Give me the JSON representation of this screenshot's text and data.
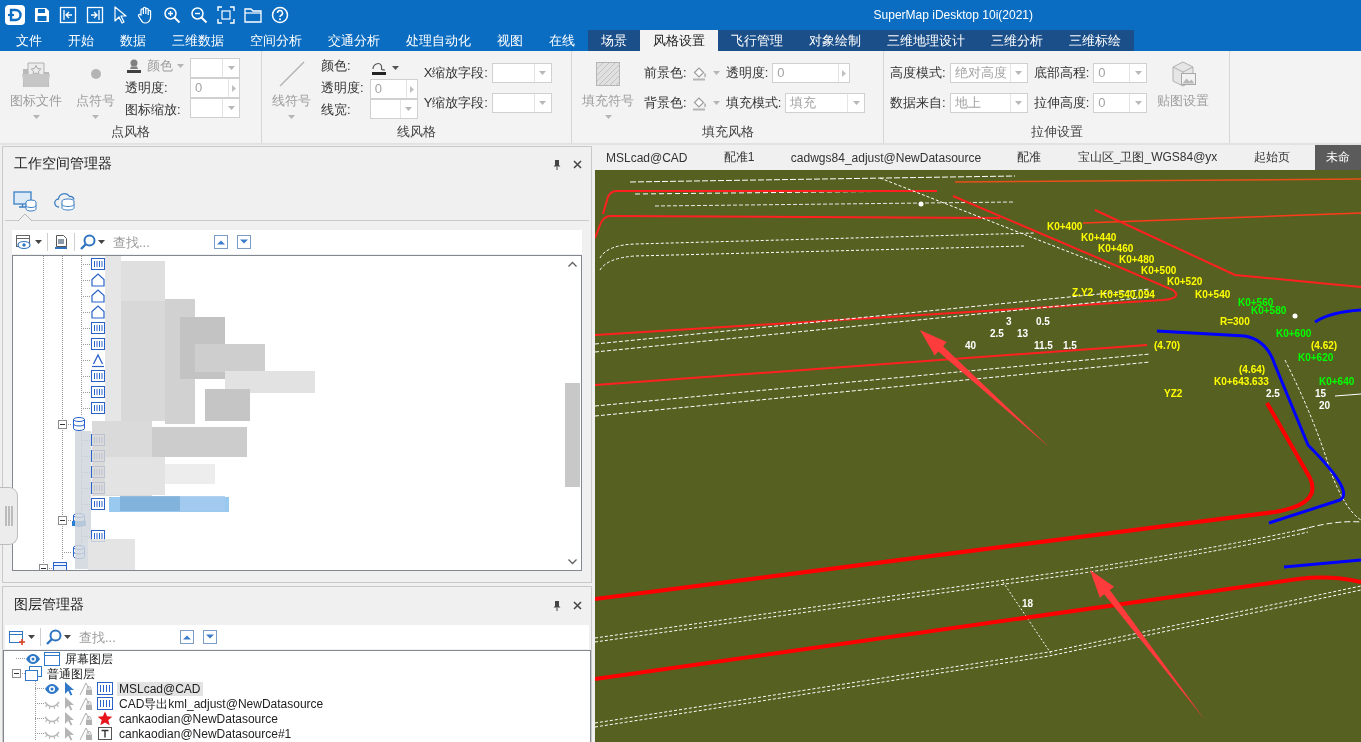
{
  "title_bar": {
    "title": "SuperMap iDesktop 10i(2021)"
  },
  "menu_tabs": [
    {
      "label": "文件",
      "selected": false,
      "contextual": false
    },
    {
      "label": "开始",
      "selected": false,
      "contextual": false
    },
    {
      "label": "数据",
      "selected": false,
      "contextual": false
    },
    {
      "label": "三维数据",
      "selected": false,
      "contextual": false
    },
    {
      "label": "空间分析",
      "selected": false,
      "contextual": false
    },
    {
      "label": "交通分析",
      "selected": false,
      "contextual": false
    },
    {
      "label": "处理自动化",
      "selected": false,
      "contextual": false
    },
    {
      "label": "视图",
      "selected": false,
      "contextual": false
    },
    {
      "label": "在线",
      "selected": false,
      "contextual": false
    },
    {
      "label": "场景",
      "selected": false,
      "contextual": true
    },
    {
      "label": "风格设置",
      "selected": true,
      "contextual": true
    },
    {
      "label": "飞行管理",
      "selected": false,
      "contextual": true
    },
    {
      "label": "对象绘制",
      "selected": false,
      "contextual": true
    },
    {
      "label": "三维地理设计",
      "selected": false,
      "contextual": true
    },
    {
      "label": "三维分析",
      "selected": false,
      "contextual": true
    },
    {
      "label": "三维标绘",
      "selected": false,
      "contextual": true
    }
  ],
  "ribbon": {
    "groups": [
      {
        "title": "点风格",
        "columns": [
          [
            {
              "kind": "large-button",
              "label": "图标文件",
              "disabled": true,
              "dropdown": true
            }
          ],
          [
            {
              "kind": "large-button",
              "label": "点符号",
              "disabled": true,
              "dropdown": true
            }
          ],
          [
            {
              "kind": "color-menu",
              "label": "颜色",
              "disabled": true
            },
            {
              "kind": "label",
              "label": "透明度:"
            },
            {
              "kind": "label",
              "label": "图标缩放:"
            }
          ],
          [
            {
              "kind": "combo",
              "disabled": true
            },
            {
              "kind": "spin",
              "value": "0",
              "disabled": true
            },
            {
              "kind": "combo",
              "disabled": true
            }
          ]
        ]
      },
      {
        "title": "线风格",
        "columns": [
          [
            {
              "kind": "large-button",
              "label": "线符号",
              "disabled": true,
              "dropdown": true
            }
          ],
          [
            {
              "kind": "label",
              "label": "颜色:"
            },
            {
              "kind": "label",
              "label": "透明度:"
            },
            {
              "kind": "label",
              "label": "线宽:"
            }
          ],
          [
            {
              "kind": "color-button",
              "disabled": false
            },
            {
              "kind": "spin",
              "value": "0",
              "disabled": true
            },
            {
              "kind": "combo",
              "disabled": true
            }
          ],
          [
            {
              "kind": "labeled-combo",
              "label": "X缩放字段:",
              "disabled": true
            },
            {
              "kind": "labeled-combo",
              "label": "Y缩放字段:",
              "disabled": true
            }
          ]
        ]
      },
      {
        "title": "填充风格",
        "columns": [
          [
            {
              "kind": "large-button",
              "label": "填充符号",
              "disabled": true,
              "dropdown": true
            }
          ],
          [
            {
              "kind": "labeled-color",
              "label": "前景色:",
              "disabled": true
            },
            {
              "kind": "labeled-color",
              "label": "背景色:",
              "disabled": true
            }
          ],
          [
            {
              "kind": "labeled-spin",
              "label": "透明度:",
              "value": "0",
              "disabled": true
            },
            {
              "kind": "labeled-combo",
              "label": "填充模式:",
              "value": "填充",
              "disabled": true
            }
          ]
        ]
      },
      {
        "title": "拉伸设置",
        "columns": [
          [
            {
              "kind": "labeled-combo",
              "label": "高度模式:",
              "value": "绝对高度",
              "disabled": true
            },
            {
              "kind": "labeled-combo",
              "label": "数据来自:",
              "value": "地上",
              "disabled": true
            }
          ],
          [
            {
              "kind": "labeled-combo",
              "label": "底部高程:",
              "value": "0",
              "disabled": true
            },
            {
              "kind": "labeled-combo",
              "label": "拉伸高度:",
              "value": "0",
              "disabled": true
            }
          ],
          [
            {
              "kind": "large-button",
              "label": "贴图设置",
              "disabled": true,
              "dropdown": false
            }
          ]
        ]
      }
    ]
  },
  "workspace_manager": {
    "title": "工作空间管理器",
    "tabs": [
      {
        "selected": true
      },
      {
        "selected": false
      }
    ],
    "search": {
      "placeholder": "查找..."
    },
    "tree": [
      {
        "kind": "offscreen",
        "children": [
          {
            "kind": "offscreen",
            "children": [
              {
                "kind": "offscreen",
                "children": [
                  {
                    "kind": "cad",
                    "selected": false
                  },
                  {
                    "kind": "region",
                    "selected": false
                  },
                  {
                    "kind": "region",
                    "selected": false
                  },
                  {
                    "kind": "region",
                    "selected": false
                  },
                  {
                    "kind": "cad",
                    "selected": false
                  },
                  {
                    "kind": "cad",
                    "selected": false
                  },
                  {
                    "kind": "text",
                    "selected": false
                  },
                  {
                    "kind": "cad",
                    "selected": false
                  },
                  {
                    "kind": "cad",
                    "selected": false
                  },
                  {
                    "kind": "cad",
                    "selected": false
                  }
                ]
              },
              {
                "kind": "datasource",
                "expanded": true,
                "selected": false,
                "children": [
                  {
                    "kind": "cad",
                    "selected": false
                  },
                  {
                    "kind": "cad",
                    "selected": false
                  },
                  {
                    "kind": "cad",
                    "selected": false
                  },
                  {
                    "kind": "cad",
                    "selected": false
                  },
                  {
                    "kind": "cad",
                    "selected": true
                  }
                ]
              },
              {
                "kind": "udb",
                "expanded": true,
                "selected": false,
                "children": [
                  {
                    "kind": "cad",
                    "selected": false
                  }
                ]
              },
              {
                "kind": "datasource",
                "selected": false
              }
            ]
          },
          {
            "kind": "map",
            "expanded": true,
            "selected": false
          }
        ]
      }
    ]
  },
  "layer_manager": {
    "title": "图层管理器",
    "search": {
      "placeholder": "查找..."
    },
    "tree": [
      {
        "kind": "screen",
        "label": "屏幕图层",
        "visible": true,
        "selected": false
      },
      {
        "kind": "group",
        "label": "普通图层",
        "expanded": true,
        "selected": false,
        "children": [
          {
            "kind": "cad",
            "label": "MSLcad@CAD",
            "visible": true,
            "selectable": true,
            "selected": true
          },
          {
            "kind": "cad",
            "label": "CAD导出kml_adjust@NewDatasource",
            "visible": false,
            "selectable": false,
            "selected": false
          },
          {
            "kind": "point",
            "label": "cankaodian@NewDatasource",
            "visible": false,
            "selectable": false,
            "selected": false
          },
          {
            "kind": "text",
            "label": "cankaodian@NewDatasource#1",
            "visible": false,
            "selectable": false,
            "selected": false
          }
        ]
      }
    ]
  },
  "map_view": {
    "tabs": [
      {
        "label": "MSLcad@CAD",
        "selected": false
      },
      {
        "label": "配准1",
        "selected": false
      },
      {
        "label": "cadwgs84_adjust@NewDatasource",
        "selected": false
      },
      {
        "label": "配准",
        "selected": false
      },
      {
        "label": "宝山区_卫图_WGS84@yx",
        "selected": false
      },
      {
        "label": "起始页",
        "selected": false
      },
      {
        "label": "未命",
        "selected": true
      }
    ],
    "labels": [
      {
        "text": "K0+400",
        "color": "#ffff00"
      },
      {
        "text": "K0+440",
        "color": "#ffff00"
      },
      {
        "text": "K0+460",
        "color": "#ffff00"
      },
      {
        "text": "K0+480",
        "color": "#ffff00"
      },
      {
        "text": "K0+500",
        "color": "#ffff00"
      },
      {
        "text": "K0+520",
        "color": "#ffff00"
      },
      {
        "text": "Z.Y2",
        "color": "#ffff00"
      },
      {
        "text": "K0+540.094",
        "color": "#ffff00"
      },
      {
        "text": "K0+540",
        "color": "#ffff00"
      },
      {
        "text": "K0+560",
        "color": "#00ff00"
      },
      {
        "text": "K0+580",
        "color": "#00ff00"
      },
      {
        "text": "3",
        "color": "#ffffff"
      },
      {
        "text": "0.5",
        "color": "#ffffff"
      },
      {
        "text": "R=300",
        "color": "#ffff00"
      },
      {
        "text": "2.5",
        "color": "#ffffff"
      },
      {
        "text": "13",
        "color": "#ffffff"
      },
      {
        "text": "K0+600",
        "color": "#00ff00"
      },
      {
        "text": "40",
        "color": "#ffffff"
      },
      {
        "text": "11.5",
        "color": "#ffffff"
      },
      {
        "text": "1.5",
        "color": "#ffffff"
      },
      {
        "text": "(4.70)",
        "color": "#ffff00"
      },
      {
        "text": "(4.62)",
        "color": "#ffff00"
      },
      {
        "text": "K0+620",
        "color": "#00ff00"
      },
      {
        "text": "(4.64)",
        "color": "#ffff00"
      },
      {
        "text": "K0+643.633",
        "color": "#ffff00"
      },
      {
        "text": "K0+640",
        "color": "#00ff00"
      },
      {
        "text": "YZ2",
        "color": "#ffff00"
      },
      {
        "text": "2.5",
        "color": "#ffffff"
      },
      {
        "text": "15",
        "color": "#ffffff"
      },
      {
        "text": "20",
        "color": "#ffffff"
      },
      {
        "text": "18",
        "color": "#ffffff"
      }
    ]
  }
}
